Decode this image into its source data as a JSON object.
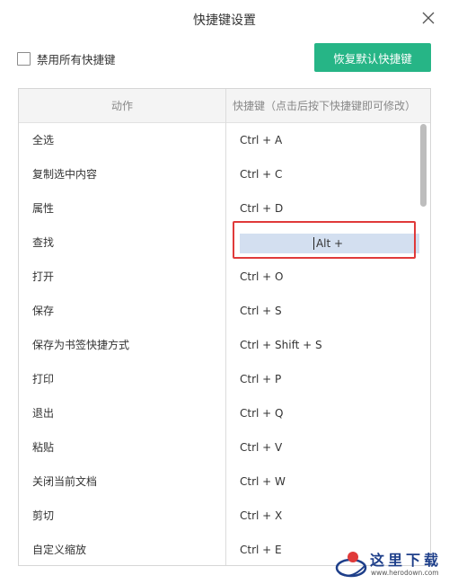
{
  "window": {
    "title": "快捷键设置",
    "close_icon": "close-icon"
  },
  "toolbar": {
    "disable_all_label": "禁用所有快捷键",
    "disable_all_checked": false,
    "restore_default_label": "恢复默认快捷键"
  },
  "colors": {
    "accent": "#26b586",
    "highlight_border": "#e03a3a",
    "editing_bg": "#d3dff0"
  },
  "table": {
    "headers": {
      "action": "动作",
      "shortcut": "快捷键（点击后按下快捷键即可修改）"
    },
    "rows": [
      {
        "action": "全选",
        "shortcut": "Ctrl + A"
      },
      {
        "action": "复制选中内容",
        "shortcut": "Ctrl + C"
      },
      {
        "action": "属性",
        "shortcut": "Ctrl + D"
      },
      {
        "action": "查找",
        "shortcut": "Alt +",
        "editing": true
      },
      {
        "action": "打开",
        "shortcut": "Ctrl + O"
      },
      {
        "action": "保存",
        "shortcut": "Ctrl + S"
      },
      {
        "action": "保存为书签快捷方式",
        "shortcut": "Ctrl + Shift + S"
      },
      {
        "action": "打印",
        "shortcut": "Ctrl + P"
      },
      {
        "action": "退出",
        "shortcut": "Ctrl + Q"
      },
      {
        "action": "粘贴",
        "shortcut": "Ctrl + V"
      },
      {
        "action": "关闭当前文档",
        "shortcut": "Ctrl + W"
      },
      {
        "action": "剪切",
        "shortcut": "Ctrl + X"
      },
      {
        "action": "自定义缩放",
        "shortcut": "Ctrl + E"
      }
    ]
  },
  "watermark": {
    "text": "这里下载",
    "url": "www.herodown.com"
  }
}
